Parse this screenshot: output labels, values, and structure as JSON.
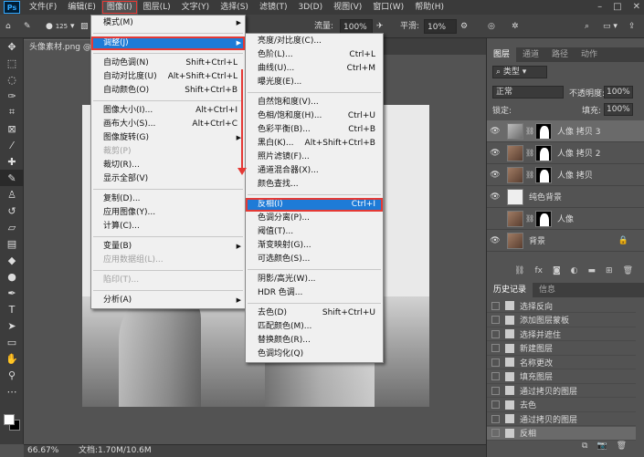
{
  "menubar": {
    "logo": "Ps",
    "items": [
      "文件(F)",
      "编辑(E)",
      "图像(I)",
      "图层(L)",
      "文字(Y)",
      "选择(S)",
      "滤镜(T)",
      "3D(D)",
      "视图(V)",
      "窗口(W)",
      "帮助(H)"
    ],
    "window_controls": [
      "–",
      "□",
      "✕"
    ]
  },
  "options": {
    "brush_size": "125",
    "mode_label": "模",
    "flow_label": "流量:",
    "flow_value": "100%",
    "smooth_label": "平滑:",
    "smooth_value": "10%"
  },
  "doc_tab": "头像素材.png @",
  "image_menu": {
    "items": [
      {
        "label": "模式(M)",
        "shortcut": "",
        "sub": true
      },
      {
        "sep": true
      },
      {
        "label": "调整(J)",
        "shortcut": "",
        "sub": true,
        "highlight": true
      },
      {
        "sep": true
      },
      {
        "label": "自动色调(N)",
        "shortcut": "Shift+Ctrl+L"
      },
      {
        "label": "自动对比度(U)",
        "shortcut": "Alt+Shift+Ctrl+L"
      },
      {
        "label": "自动颜色(O)",
        "shortcut": "Shift+Ctrl+B"
      },
      {
        "sep": true
      },
      {
        "label": "图像大小(I)...",
        "shortcut": "Alt+Ctrl+I"
      },
      {
        "label": "画布大小(S)...",
        "shortcut": "Alt+Ctrl+C"
      },
      {
        "label": "图像旋转(G)",
        "shortcut": "",
        "sub": true
      },
      {
        "label": "裁剪(P)",
        "shortcut": "",
        "disabled": true
      },
      {
        "label": "裁切(R)...",
        "shortcut": ""
      },
      {
        "label": "显示全部(V)",
        "shortcut": ""
      },
      {
        "sep": true
      },
      {
        "label": "复制(D)...",
        "shortcut": ""
      },
      {
        "label": "应用图像(Y)...",
        "shortcut": ""
      },
      {
        "label": "计算(C)...",
        "shortcut": ""
      },
      {
        "sep": true
      },
      {
        "label": "变量(B)",
        "shortcut": "",
        "sub": true
      },
      {
        "label": "应用数据组(L)...",
        "shortcut": "",
        "disabled": true
      },
      {
        "sep": true
      },
      {
        "label": "陷印(T)...",
        "shortcut": "",
        "disabled": true
      },
      {
        "sep": true
      },
      {
        "label": "分析(A)",
        "shortcut": "",
        "sub": true
      }
    ]
  },
  "adjust_menu": {
    "items": [
      {
        "label": "亮度/对比度(C)...",
        "shortcut": ""
      },
      {
        "label": "色阶(L)...",
        "shortcut": "Ctrl+L"
      },
      {
        "label": "曲线(U)...",
        "shortcut": "Ctrl+M"
      },
      {
        "label": "曝光度(E)...",
        "shortcut": ""
      },
      {
        "sep": true
      },
      {
        "label": "自然饱和度(V)...",
        "shortcut": ""
      },
      {
        "label": "色相/饱和度(H)...",
        "shortcut": "Ctrl+U"
      },
      {
        "label": "色彩平衡(B)...",
        "shortcut": "Ctrl+B"
      },
      {
        "label": "黑白(K)...",
        "shortcut": "Alt+Shift+Ctrl+B"
      },
      {
        "label": "照片滤镜(F)...",
        "shortcut": ""
      },
      {
        "label": "通道混合器(X)...",
        "shortcut": ""
      },
      {
        "label": "颜色查找...",
        "shortcut": ""
      },
      {
        "sep": true
      },
      {
        "label": "反相(I)",
        "shortcut": "Ctrl+I",
        "highlight": true
      },
      {
        "label": "色调分离(P)...",
        "shortcut": ""
      },
      {
        "label": "阈值(T)...",
        "shortcut": ""
      },
      {
        "label": "渐变映射(G)...",
        "shortcut": ""
      },
      {
        "label": "可选颜色(S)...",
        "shortcut": ""
      },
      {
        "sep": true
      },
      {
        "label": "阴影/高光(W)...",
        "shortcut": ""
      },
      {
        "label": "HDR 色调...",
        "shortcut": ""
      },
      {
        "sep": true
      },
      {
        "label": "去色(D)",
        "shortcut": "Shift+Ctrl+U"
      },
      {
        "label": "匹配颜色(M)...",
        "shortcut": ""
      },
      {
        "label": "替换颜色(R)...",
        "shortcut": ""
      },
      {
        "label": "色调均化(Q)",
        "shortcut": ""
      }
    ]
  },
  "layers_panel": {
    "tabs": [
      "图层",
      "通道",
      "路径",
      "动作"
    ],
    "filter_label": "类型",
    "blend_mode": "正常",
    "opacity_label": "不透明度:",
    "opacity_value": "100%",
    "lock_label": "锁定:",
    "fill_label": "填充:",
    "fill_value": "100%",
    "layers": [
      {
        "name": "人像 拷贝 3",
        "visible": true,
        "thumb": "gray",
        "mask": true,
        "selected": true
      },
      {
        "name": "人像 拷贝 2",
        "visible": true,
        "thumb": "color",
        "mask": true
      },
      {
        "name": "人像 拷贝",
        "visible": true,
        "thumb": "color",
        "mask": true
      },
      {
        "name": "纯色背景",
        "visible": true,
        "thumb": "white",
        "mask": false
      },
      {
        "name": "人像",
        "visible": false,
        "thumb": "color",
        "mask": true
      },
      {
        "name": "背景",
        "visible": true,
        "thumb": "color",
        "mask": false,
        "locked": true
      }
    ],
    "footer_icons": [
      "link-icon",
      "fx-icon",
      "mask-icon",
      "adjustment-icon",
      "folder-icon",
      "new-layer-icon",
      "trash-icon"
    ]
  },
  "history_panel": {
    "tabs": [
      "历史记录",
      "信息"
    ],
    "items": [
      "选择反向",
      "添加图层蒙板",
      "选择并遮住",
      "新建图层",
      "名称更改",
      "填充图层",
      "通过拷贝的图层",
      "去色",
      "通过拷贝的图层",
      "反相"
    ],
    "selected_index": 9
  },
  "status": {
    "zoom": "66.67%",
    "doc_info": "文档:1.70M/10.6M"
  }
}
